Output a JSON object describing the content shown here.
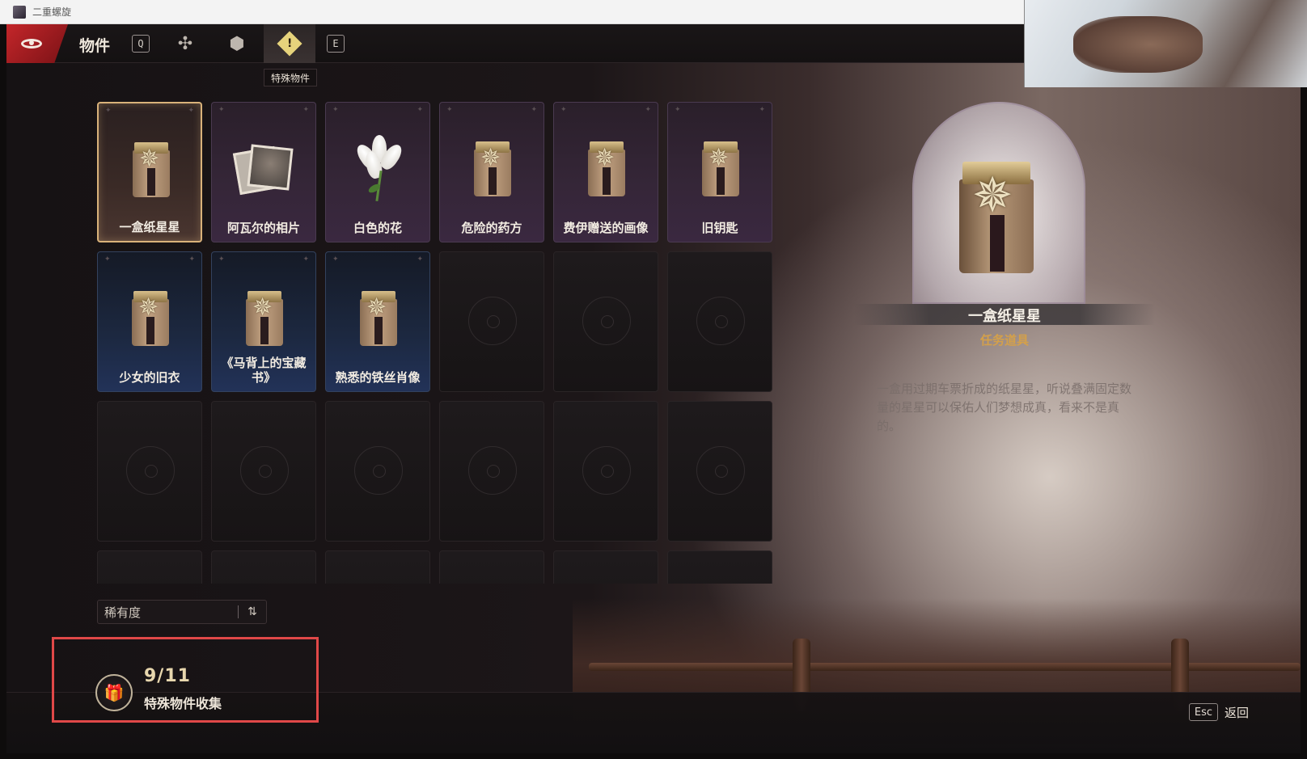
{
  "window": {
    "title": "二重螺旋"
  },
  "nav": {
    "title": "物件",
    "left_key": "Q",
    "right_key": "E",
    "tabs": [
      {
        "icon": "butterfly-icon"
      },
      {
        "icon": "cube-icon"
      },
      {
        "icon": "warning-diamond-icon",
        "active": true,
        "tooltip": "特殊物件"
      }
    ],
    "tooltip": "特殊物件"
  },
  "items": [
    {
      "label": "一盒纸星星",
      "art": "bag",
      "rarity": "gold",
      "selected": true
    },
    {
      "label": "阿瓦尔的相片",
      "art": "photo",
      "rarity": "purple"
    },
    {
      "label": "白色的花",
      "art": "flower",
      "rarity": "purple"
    },
    {
      "label": "危险的药方",
      "art": "bag",
      "rarity": "purple"
    },
    {
      "label": "费伊赠送的画像",
      "art": "bag",
      "rarity": "purple"
    },
    {
      "label": "旧钥匙",
      "art": "bag",
      "rarity": "purple"
    },
    {
      "label": "少女的旧衣",
      "art": "bag",
      "rarity": "blue"
    },
    {
      "label": "《马背上的宝藏书》",
      "art": "bag",
      "rarity": "blue"
    },
    {
      "label": "熟悉的铁丝肖像",
      "art": "bag",
      "rarity": "blue"
    }
  ],
  "sort": {
    "label": "稀有度",
    "icon": "sort-icon"
  },
  "collection": {
    "count": "9/11",
    "label": "特殊物件收集"
  },
  "footer": {
    "esc_key": "Esc",
    "back_label": "返回"
  },
  "detail": {
    "name": "一盒纸星星",
    "type": "任务道具",
    "description": "一盒用过期车票折成的纸星星，听说叠满固定数量的星星可以保佑人们梦想成真，看来不是真的。"
  },
  "colors": {
    "accent_red": "#c4262a",
    "gold": "#d4a04a",
    "highlight_box": "#e04848"
  }
}
